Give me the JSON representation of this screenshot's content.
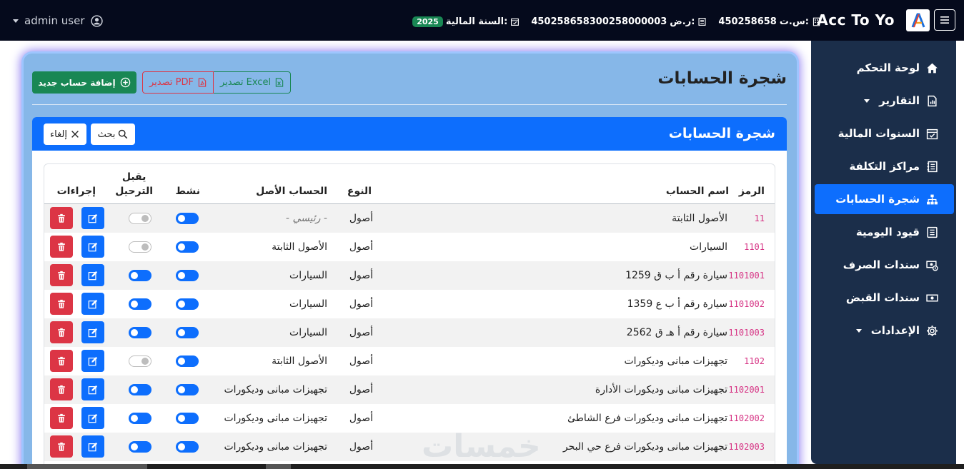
{
  "topbar": {
    "user_name": "admin user",
    "brand": "Acc To Yo",
    "logo_letter": "A",
    "fiscal_year_label": "السنة المالية:",
    "fiscal_year": "2025",
    "vat_label": "ر.ض:",
    "vat_number": "450258658300258000003",
    "cr_label": "س.ت:",
    "cr_number": "450258658"
  },
  "sidebar": {
    "items": [
      {
        "label": "لوحة التحكم",
        "icon": "home-icon"
      },
      {
        "label": "التقارير",
        "icon": "report-icon",
        "has_submenu": true
      },
      {
        "label": "السنوات المالية",
        "icon": "calendar-check-icon"
      },
      {
        "label": "مراكز التكلفة",
        "icon": "journal-icon"
      },
      {
        "label": "شجرة الحسابات",
        "icon": "diagram-icon",
        "active": true
      },
      {
        "label": "قيود اليومية",
        "icon": "list-icon"
      },
      {
        "label": "سندات الصرف",
        "icon": "cash-out-icon"
      },
      {
        "label": "سندات القبض",
        "icon": "cash-in-icon"
      },
      {
        "label": "الإعدادات",
        "icon": "gear-icon",
        "has_submenu": true
      }
    ]
  },
  "page": {
    "title": "شجرة الحسابات",
    "add_button": "إضافة حساب جديد",
    "export_pdf": "تصدير PDF",
    "export_excel": "تصدير Excel"
  },
  "card": {
    "title": "شجرة الحسابات",
    "search_button": "بحث",
    "cancel_button": "إلغاء"
  },
  "table": {
    "headers": {
      "code": "الرمز",
      "name": "اسم الحساب",
      "type": "النوع",
      "parent": "الحساب الأصل",
      "active": "نشط",
      "posting_line1": "يقبل",
      "posting_line2": "الترحيل",
      "actions": "إجراءات"
    },
    "rows": [
      {
        "code": "11",
        "name": "الأصول الثابتة",
        "type": "أصول",
        "parent": "- رئيسي -",
        "active": true,
        "posting": false
      },
      {
        "code": "1101",
        "name": "السيارات",
        "type": "أصول",
        "parent": "الأصول الثابتة",
        "active": true,
        "posting": false
      },
      {
        "code": "1101001",
        "name": "سيارة رقم أ ب ق 1259",
        "type": "أصول",
        "parent": "السيارات",
        "active": true,
        "posting": true
      },
      {
        "code": "1101002",
        "name": "سيارة رقم أ ب ع 1359",
        "type": "أصول",
        "parent": "السيارات",
        "active": true,
        "posting": true
      },
      {
        "code": "1101003",
        "name": "سيارة رقم أ هـ ق 2562",
        "type": "أصول",
        "parent": "السيارات",
        "active": true,
        "posting": true
      },
      {
        "code": "1102",
        "name": "تجهيزات مبانى وديكورات",
        "type": "أصول",
        "parent": "الأصول الثابتة",
        "active": true,
        "posting": false
      },
      {
        "code": "1102001",
        "name": "تجهيزات مبانى وديكورات الأدارة",
        "type": "أصول",
        "parent": "تجهيزات مبانى وديكورات",
        "active": true,
        "posting": true
      },
      {
        "code": "1102002",
        "name": "تجهيزات مبانى وديكورات فرع الشاطئ",
        "type": "أصول",
        "parent": "تجهيزات مبانى وديكورات",
        "active": true,
        "posting": true
      },
      {
        "code": "1102003",
        "name": "تجهيزات مبانى وديكورات فرع حي البحر",
        "type": "أصول",
        "parent": "تجهيزات مبانى وديكورات",
        "active": true,
        "posting": true
      }
    ]
  },
  "watermark": "خمسات",
  "colors": {
    "navbar": "#050a1c",
    "sidebar": "#1b2e4a",
    "primary": "#0d6efd",
    "success": "#198754",
    "danger": "#dc3545",
    "panel": "#86b7e8"
  }
}
